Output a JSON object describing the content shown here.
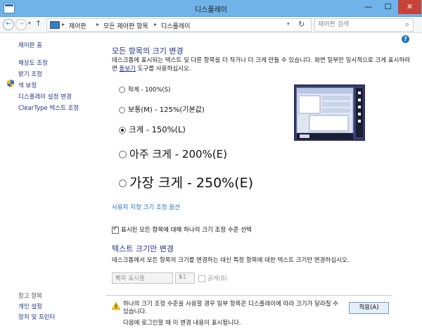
{
  "window": {
    "title": "디스플레이",
    "minimize": "—",
    "maximize": "☐",
    "close": "✕"
  },
  "nav": {
    "back": "←",
    "forward": "→",
    "recent": "▾",
    "up": "↑",
    "breadcrumbs": [
      "제어판",
      "모든 제어판 항목",
      "디스플레이"
    ],
    "separator": "▸",
    "dropdown": "▾",
    "refresh": "↻",
    "search_placeholder": "제어판 검색",
    "search_icon": "⌕"
  },
  "help_label": "?",
  "sidebar": {
    "home": "제어판 홈",
    "items": [
      "해상도 조정",
      "밝기 조정",
      "색 보정",
      "디스플레이 설정 변경",
      "ClearType 텍스트 조정"
    ],
    "see_also_title": "참고 항목",
    "see_also": [
      "개인 설정",
      "장치 및 프린터"
    ]
  },
  "main": {
    "heading": "모든 항목의 크기 변경",
    "description_part1": "데스크톱에 표시되는 텍스트 및 다른 항목을 더 작거나 더 크게 만들 수 있습니다. 화면 일부만 일시적으로 크게 표시하려면 ",
    "description_link": "돋보기",
    "description_part2": " 도구를 사용하십시오.",
    "options": [
      {
        "label": "작게 - 100%(S)",
        "checked": false
      },
      {
        "label": "보통(M) - 125%(기본값)",
        "checked": false
      },
      {
        "label": "크게 - 150%(L)",
        "checked": true
      },
      {
        "label": "아주 크게 - 200%(E)",
        "checked": false
      },
      {
        "label": "가장 크게 - 250%(E)",
        "checked": false
      }
    ],
    "custom_link": "사용자 지정 크기 조정 옵션",
    "single_scale_checkbox": "표시된 모든 항목에 대해 하나의 크기 조정 수준 선택",
    "single_scale_checked": true,
    "heading2": "텍스트 크기만 변경",
    "description2": "데스크톱에서 모든 항목의 크기를 변경하는 대신 특정 항목에 대한 텍스트 크기만 변경하십시오.",
    "item_select": "제목 표시줄",
    "size_select": "11",
    "bold_label": "굵게(B)",
    "bold_checked": false
  },
  "info": {
    "warning": "하나의 크기 조정 수준을 사용할 경우 일부 항목은 디스플레이에 따라 크기가 달라질 수 있습니다.",
    "logon_note": "다음에 로그인할 때 이 변경 내용이 표시됩니다.",
    "apply_button": "적용(A)"
  },
  "colors": {
    "titlebar": "#6fb3e8",
    "link": "#1e3287",
    "heading": "#1e3287",
    "close_button": "#c7433a"
  }
}
